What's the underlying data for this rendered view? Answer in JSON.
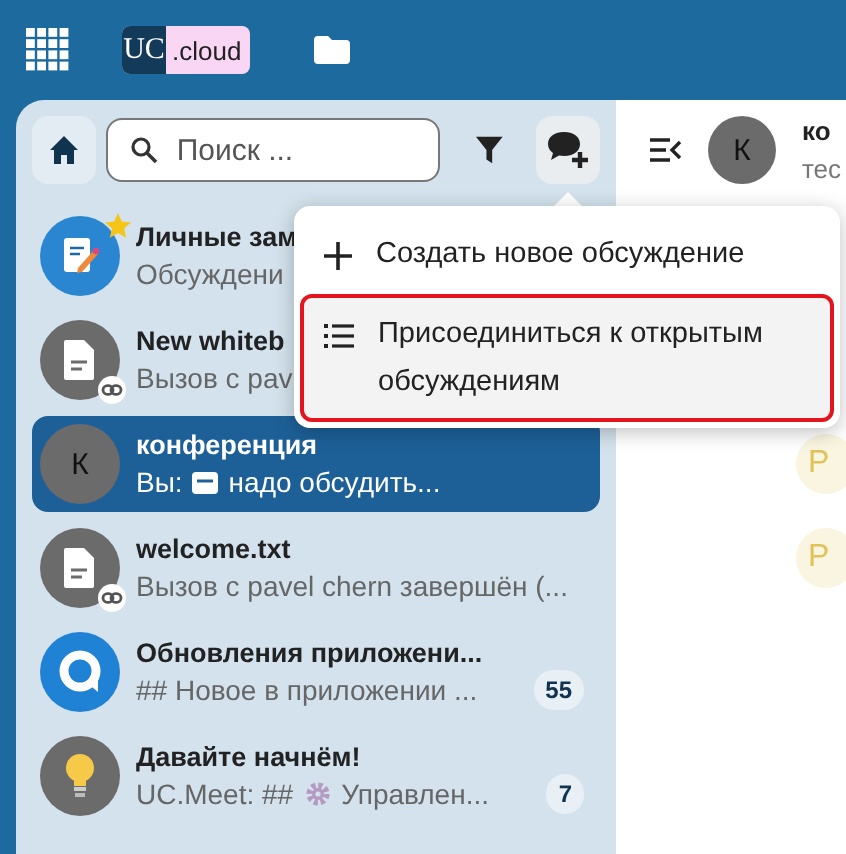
{
  "topbar": {
    "logo_mark": "UC",
    "logo_text": ".cloud"
  },
  "search": {
    "placeholder": "Поиск ..."
  },
  "conversations": [
    {
      "title": "Личные зам",
      "preview": [
        {
          "kind": "text",
          "text": "Обсуждени"
        }
      ],
      "kind": "note",
      "favorite": true,
      "link": false,
      "selected": false
    },
    {
      "title": "New whiteb",
      "preview": [
        {
          "kind": "text",
          "text": "Вызов с pav"
        }
      ],
      "kind": "file",
      "favorite": false,
      "link": true,
      "selected": false
    },
    {
      "title": "конференция",
      "preview": [
        {
          "kind": "text",
          "text": "Вы:"
        },
        {
          "kind": "message"
        },
        {
          "kind": "text",
          "text": "надо обсудить..."
        }
      ],
      "kind": "letter",
      "initial": "К",
      "favorite": false,
      "link": false,
      "selected": true
    },
    {
      "title": "welcome.txt",
      "preview": [
        {
          "kind": "text",
          "text": "Вызов с pavel chern завершён (..."
        }
      ],
      "kind": "file",
      "favorite": false,
      "link": true,
      "selected": false
    },
    {
      "title": "Обновления приложени...",
      "preview": [
        {
          "kind": "text",
          "text": "## Новое в приложении ..."
        }
      ],
      "kind": "app",
      "favorite": false,
      "link": false,
      "selected": false,
      "unread": "55"
    },
    {
      "title": "Давайте начнём!",
      "preview": [
        {
          "kind": "text",
          "text": "UC.Meet: ##"
        },
        {
          "kind": "gear"
        },
        {
          "kind": "text",
          "text": "Управлен..."
        }
      ],
      "kind": "bulb",
      "favorite": false,
      "link": false,
      "selected": false,
      "unread": "7"
    }
  ],
  "menu": {
    "items": [
      {
        "label": "Создать новое обсуждение",
        "kind": "create",
        "selected": false
      },
      {
        "label": "Присоединиться к открытым обсуждениям",
        "kind": "join",
        "selected": true
      }
    ]
  },
  "chat_header": {
    "initial": "К",
    "title": "ко",
    "subtitle": "тес"
  },
  "participants": [
    {
      "initials": "Р"
    },
    {
      "initials": "Р"
    }
  ]
}
